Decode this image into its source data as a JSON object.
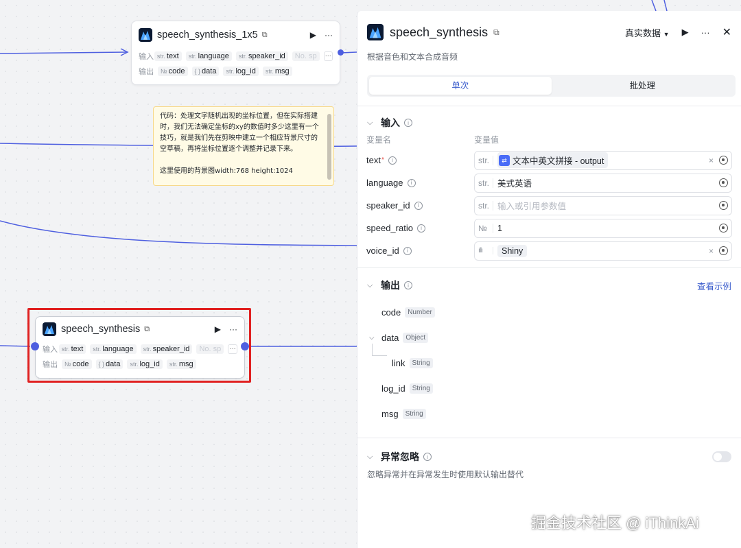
{
  "canvas": {
    "node_top": {
      "title": "speech_synthesis_1x5",
      "input_label": "输入",
      "output_label": "输出",
      "inputs": [
        {
          "type": "str.",
          "name": "text"
        },
        {
          "type": "str.",
          "name": "language"
        },
        {
          "type": "str.",
          "name": "speaker_id"
        },
        {
          "type": "",
          "name": "No. sp"
        }
      ],
      "outputs": [
        {
          "type": "№",
          "name": "code"
        },
        {
          "type": "{ }",
          "name": "data"
        },
        {
          "type": "str.",
          "name": "log_id"
        },
        {
          "type": "str.",
          "name": "msg"
        }
      ],
      "more": "···"
    },
    "node_selected": {
      "title": "speech_synthesis",
      "input_label": "输入",
      "output_label": "输出",
      "inputs": [
        {
          "type": "str.",
          "name": "text"
        },
        {
          "type": "str.",
          "name": "language"
        },
        {
          "type": "str.",
          "name": "speaker_id"
        },
        {
          "type": "",
          "name": "No. sp"
        }
      ],
      "outputs": [
        {
          "type": "№",
          "name": "code"
        },
        {
          "type": "{ }",
          "name": "data"
        },
        {
          "type": "str.",
          "name": "log_id"
        },
        {
          "type": "str.",
          "name": "msg"
        }
      ],
      "more": "···"
    },
    "note": {
      "lines": [
        "代码：处理文字随机出现的坐标位置，但在实际搭建",
        "时，我们无法确定坐标的xy的数值时多少这里有一个",
        "技巧，就是我们先在剪映中建立一个相应背景尺寸的",
        "空草稿，再将坐标位置逐个调整并记录下来。",
        "",
        "这里使用的背景图width:768 height:1024"
      ]
    }
  },
  "panel": {
    "title": "speech_synthesis",
    "description": "根据音色和文本合成音频",
    "data_select": "真实数据",
    "tabs": [
      "单次",
      "批处理"
    ],
    "input_section": {
      "title": "输入",
      "col_name": "变量名",
      "col_value": "变量值",
      "params": [
        {
          "name": "text",
          "required": true,
          "type": "str.",
          "value": "文本中英文拼接 - output",
          "kind": "ref"
        },
        {
          "name": "language",
          "required": false,
          "type": "str.",
          "value": "美式英语",
          "kind": "text"
        },
        {
          "name": "speaker_id",
          "required": false,
          "type": "str.",
          "value": "输入或引用参数值",
          "kind": "placeholder"
        },
        {
          "name": "speed_ratio",
          "required": false,
          "type": "№",
          "value": "1",
          "kind": "text"
        },
        {
          "name": "voice_id",
          "required": false,
          "type": "wave",
          "value": "Shiny",
          "kind": "voice"
        }
      ]
    },
    "output_section": {
      "title": "输出",
      "example_link": "查看示例",
      "fields": [
        {
          "name": "code",
          "type": "Number"
        },
        {
          "name": "data",
          "type": "Object"
        },
        {
          "name": "link",
          "type": "String"
        },
        {
          "name": "log_id",
          "type": "String"
        },
        {
          "name": "msg",
          "type": "String"
        }
      ]
    },
    "exception_section": {
      "title": "异常忽略",
      "description": "忽略异常并在异常发生时使用默认输出替代",
      "enabled": false
    }
  },
  "watermark": "掘金技术社区 @ iThinkAi",
  "colors": {
    "accent": "#3a5ccc",
    "wire": "#4e5fe0",
    "selection": "#e02020",
    "note_bg": "#fffbe6"
  }
}
